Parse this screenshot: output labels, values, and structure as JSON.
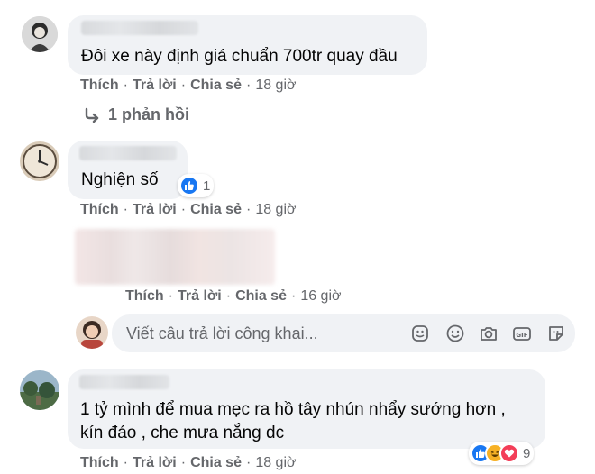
{
  "comments": [
    {
      "text": "Đôi xe này định giá chuẩn 700tr quay đầu",
      "like": "Thích",
      "reply": "Trả lời",
      "share": "Chia sẻ",
      "time": "18 giờ"
    },
    {
      "text": "Nghiện số",
      "reaction_count": "1",
      "like": "Thích",
      "reply": "Trả lời",
      "share": "Chia sẻ",
      "time": "18 giờ"
    },
    {
      "like": "Thích",
      "reply": "Trả lời",
      "share": "Chia sẻ",
      "time": "16 giờ"
    },
    {
      "text_line1": "1 tỷ mình để mua mẹc ra hồ tây nhún nhẩy sướng hơn ,",
      "text_line2": "kín đáo , che mưa nắng dc",
      "reaction_count": "9",
      "like": "Thích",
      "reply": "Trả lời",
      "share": "Chia sẻ",
      "time": "18 giờ"
    }
  ],
  "replies_link": "1 phản hồi",
  "reply_box": {
    "placeholder": "Viết câu trả lời công khai..."
  },
  "separator": "·",
  "colors": {
    "bubble": "#f0f2f5",
    "meta": "#65676b",
    "like_blue": "#1877f2",
    "love_red": "#f33e58",
    "haha_yellow": "#f7b125"
  }
}
